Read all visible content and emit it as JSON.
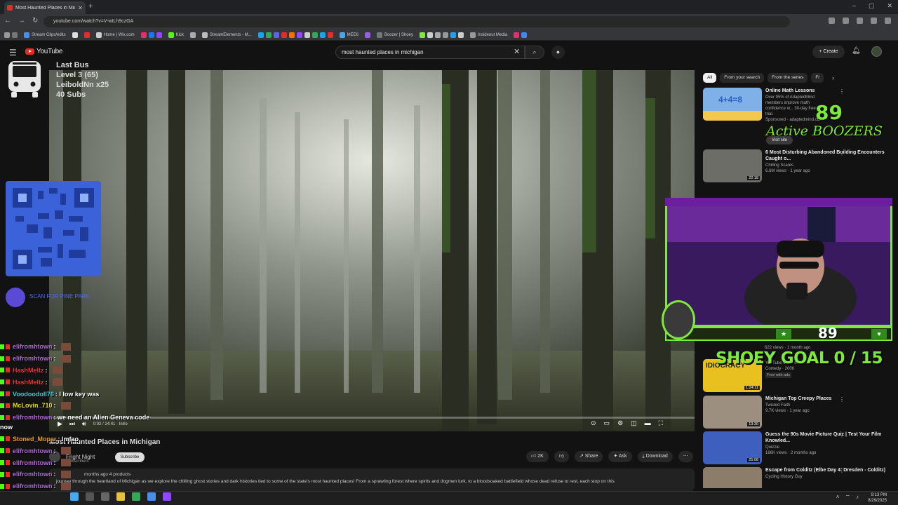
{
  "browser": {
    "tab_title": "Most Haunted Places in Michig...",
    "url": "youtube.com/watch?v=V-wtLh9czGA",
    "bookmarks": [
      "Stream Clips/edits",
      "Home | Wix.com",
      "Kick",
      "StreamElements - M...",
      "MEE6",
      "Boozer | Shoey",
      "Insideout Media"
    ]
  },
  "youtube": {
    "logo": "YouTube",
    "search_value": "most haunted places in michigan",
    "create_label": "Create",
    "video": {
      "title": "Most Haunted Places in Michigan",
      "channel": "Fright Night",
      "subscribers": "subscribers",
      "subscribe_label": "Subscribe",
      "time": "0:02 / 24:41 · Intro",
      "progress_fraction": 0.0014,
      "likes": "2K",
      "share": "Share",
      "ask": "Ask",
      "download": "Download",
      "desc_meta": "months ago  4 products",
      "description": "journey through the heartland of Michigan as we explore the chilling ghost stories and dark histories tied to some of the state's most haunted places! From a sprawling forest where spirits and dogmen lurk, to a bloodsoaked battlefield whose dead refuse to rest, each stop on this"
    },
    "chips": [
      "All",
      "From your search",
      "From the series",
      "Fr"
    ],
    "recommendations": [
      {
        "title": "Online Math Lessons",
        "meta1": "Over 95% of AdaptedMind members improve math confidence w... 30-day free trial.",
        "meta2": "Sponsored · adaptedmind.com",
        "duration": "",
        "badge": ""
      },
      {
        "title": "6 Most Disturbing Abandoned Building Encounters Caught o...",
        "meta1": "Chilling Scares",
        "meta2": "6.6M views · 1 year ago",
        "duration": "22:18",
        "badge": ""
      },
      {
        "title": "IDIOCRACY",
        "meta1": "YouTube Movies & TV",
        "meta2": "Comedy · 2006",
        "duration": "1:24:11",
        "badge": "Free with ads"
      },
      {
        "title": "Michigan Top Creepy Places",
        "meta1": "Twisted Faith",
        "meta2": "9.7K views · 1 year ago",
        "duration": "13:30",
        "badge": ""
      },
      {
        "title": "Guess the 90s Movie Picture Quiz | Test Your Film Knowled...",
        "meta1": "Quizzie",
        "meta2": "166K views · 2 months ago",
        "duration": "25:08",
        "badge": ""
      },
      {
        "title": "Escape from Colditz (Elbe Day 4: Dresden - Colditz)",
        "meta1": "Cycling History Guy",
        "meta2": "",
        "duration": "",
        "badge": ""
      }
    ],
    "rec_partial_meta": "622 views · 1 month ago",
    "visit_site": "Visit site"
  },
  "overlay": {
    "bus_lines": [
      "Last Bus",
      "Level 3 (65)",
      "LeiboldNn x25",
      "40 Subs"
    ],
    "pine_text": "SCAN FOR PINE PARK",
    "boozers_count": "89",
    "boozers_label": "Active BOOZERS",
    "webcam_count": "89",
    "goal_text": "SHOEY GOAL  0 / 15"
  },
  "chat": [
    {
      "user": "elifromhtown",
      "msg": "",
      "color": "#b06ad8"
    },
    {
      "user": "elifromhtown",
      "msg": "",
      "color": "#b06ad8"
    },
    {
      "user": "HashMeltz",
      "msg": "",
      "color": "#e8333a"
    },
    {
      "user": "HashMeltz",
      "msg": "",
      "color": "#e8333a"
    },
    {
      "user": "Voodoodoll76",
      "msg": ": I low key was",
      "color": "#3ad0e0"
    },
    {
      "user": "McLovin_710",
      "msg": "",
      "color": "#e8e000"
    },
    {
      "user": "elifromhtown",
      "msg": ": we need an Alien Geneva code",
      "color": "#b06ad8"
    },
    {
      "user": "Stoned_Mopar",
      "msg": ": lmfao",
      "color": "#e8a030"
    },
    {
      "user": "elifromhtown",
      "msg": "",
      "color": "#b06ad8"
    },
    {
      "user": "elifromhtown",
      "msg": "",
      "color": "#b06ad8"
    },
    {
      "user": "elifromhtown",
      "msg": "",
      "color": "#b06ad8"
    },
    {
      "user": "elifromhtown",
      "msg": "",
      "color": "#b06ad8"
    },
    {
      "user": "elifromhtown",
      "msg": "",
      "color": "#b06ad8"
    }
  ],
  "chat_wrap": "now",
  "taskbar": {
    "time": "9:13 PM",
    "date": "8/29/2025"
  }
}
